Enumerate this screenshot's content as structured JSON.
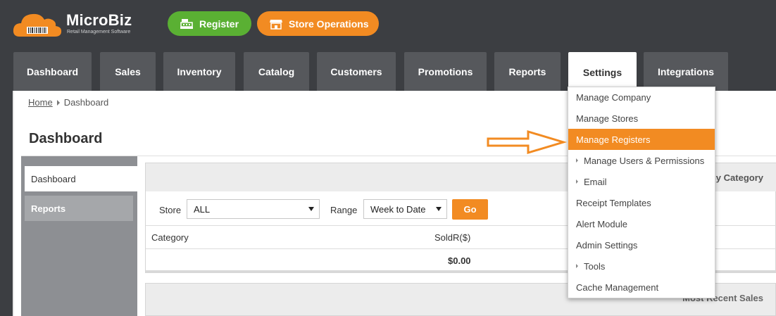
{
  "brand": {
    "name": "MicroBiz",
    "tagline": "Retail Management Software"
  },
  "actions": {
    "register": "Register",
    "store_operations": "Store Operations"
  },
  "nav": [
    "Dashboard",
    "Sales",
    "Inventory",
    "Catalog",
    "Customers",
    "Promotions",
    "Reports",
    "Settings",
    "Integrations"
  ],
  "breadcrumb": {
    "home": "Home",
    "current": "Dashboard"
  },
  "page_title": "Dashboard",
  "sidebar": [
    "Dashboard",
    "Reports"
  ],
  "panel": {
    "title": "Sales By Category",
    "filters": {
      "store_label": "Store",
      "store_value": "ALL",
      "range_label": "Range",
      "range_value": "Week to Date",
      "go": "Go"
    },
    "columns": [
      "Category",
      "SoldR($)"
    ],
    "total": "$0.00"
  },
  "panel2": {
    "title": "Most Recent Sales"
  },
  "settings_menu": [
    {
      "label": "Manage Company",
      "sub": false
    },
    {
      "label": "Manage Stores",
      "sub": false
    },
    {
      "label": "Manage Registers",
      "sub": false,
      "highlighted": true
    },
    {
      "label": "Manage Users & Permissions",
      "sub": true
    },
    {
      "label": "Email",
      "sub": true
    },
    {
      "label": "Receipt Templates",
      "sub": false
    },
    {
      "label": "Alert Module",
      "sub": false
    },
    {
      "label": "Admin Settings",
      "sub": false
    },
    {
      "label": "Tools",
      "sub": true
    },
    {
      "label": "Cache Management",
      "sub": false
    }
  ],
  "colors": {
    "orange": "#f28b22",
    "green": "#5ab033",
    "dark": "#3c3e42",
    "tab": "#56585c"
  }
}
